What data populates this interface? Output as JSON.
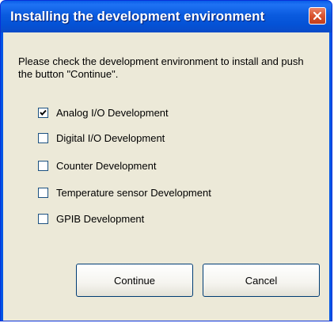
{
  "window": {
    "title": "Installing the development environment"
  },
  "dialog": {
    "instructions": "Please check the development environment to install and push the button \"Continue\".",
    "options": [
      {
        "label": "Analog I/O Development",
        "checked": true
      },
      {
        "label": "Digital I/O Development",
        "checked": false
      },
      {
        "label": "Counter Development",
        "checked": false
      },
      {
        "label": "Temperature sensor Development",
        "checked": false
      },
      {
        "label": "GPIB Development",
        "checked": false
      }
    ],
    "continue_label": "Continue",
    "cancel_label": "Cancel"
  },
  "icons": {
    "close": "close-icon",
    "check": "checkmark-icon"
  },
  "colors": {
    "titlebar": "#0a5bdf",
    "client_bg": "#ece9d8",
    "close_button": "#d9542f"
  }
}
